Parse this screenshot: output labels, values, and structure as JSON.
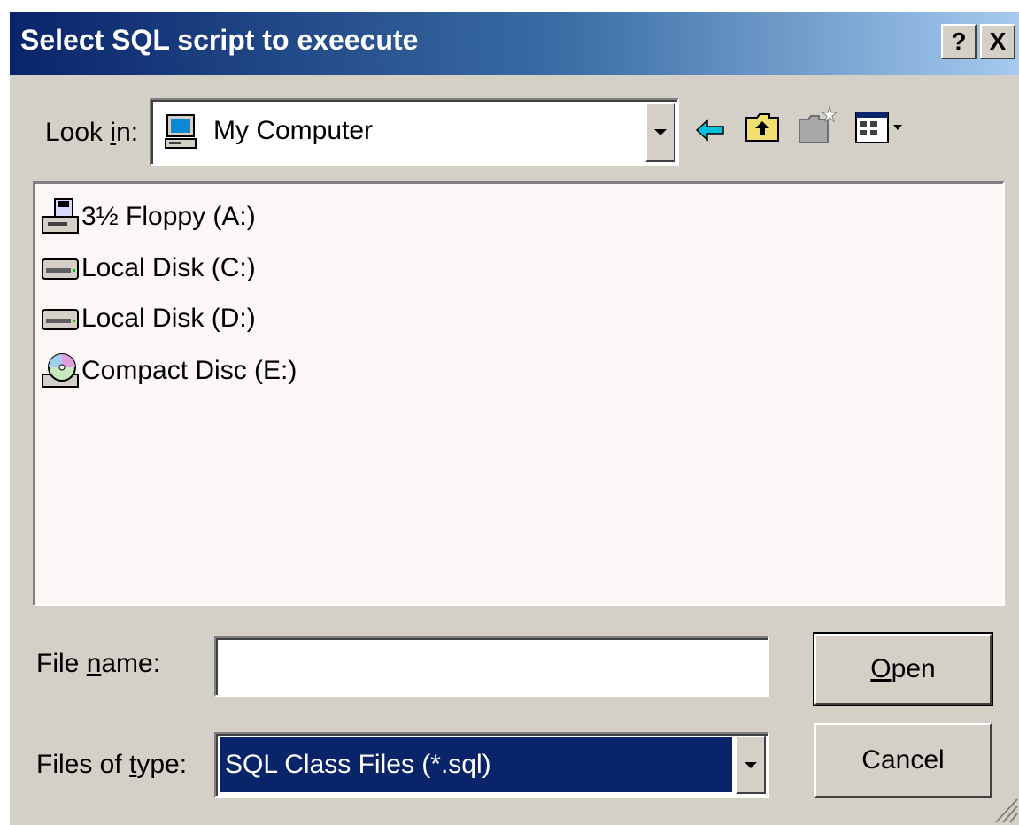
{
  "dialog": {
    "title": "Select SQL script to exeecute",
    "help_button": "?",
    "close_button": "X"
  },
  "look_in": {
    "label_pre": "Look ",
    "label_accel": "i",
    "label_post": "n:",
    "value": "My Computer"
  },
  "toolbar": {
    "icons": [
      "back-arrow-icon",
      "up-folder-icon",
      "new-folder-icon",
      "view-menu-icon"
    ]
  },
  "files": [
    {
      "label": "3½ Floppy (A:)",
      "icon": "floppy-drive-icon"
    },
    {
      "label": "Local Disk (C:)",
      "icon": "hard-disk-icon"
    },
    {
      "label": "Local Disk (D:)",
      "icon": "hard-disk-icon"
    },
    {
      "label": "Compact Disc (E:)",
      "icon": "cd-drive-icon"
    }
  ],
  "file_name": {
    "label_pre": "File ",
    "label_accel": "n",
    "label_post": "ame:",
    "value": ""
  },
  "file_type": {
    "label_pre": "Files of ",
    "label_accel": "t",
    "label_post": "ype:",
    "value": "SQL Class Files (*.sql)"
  },
  "buttons": {
    "open_accel": "O",
    "open_rest": "pen",
    "cancel": "Cancel"
  },
  "colors": {
    "title_bar": "#0a246a",
    "face": "#d4d0c8",
    "selection": "#0a246a"
  }
}
